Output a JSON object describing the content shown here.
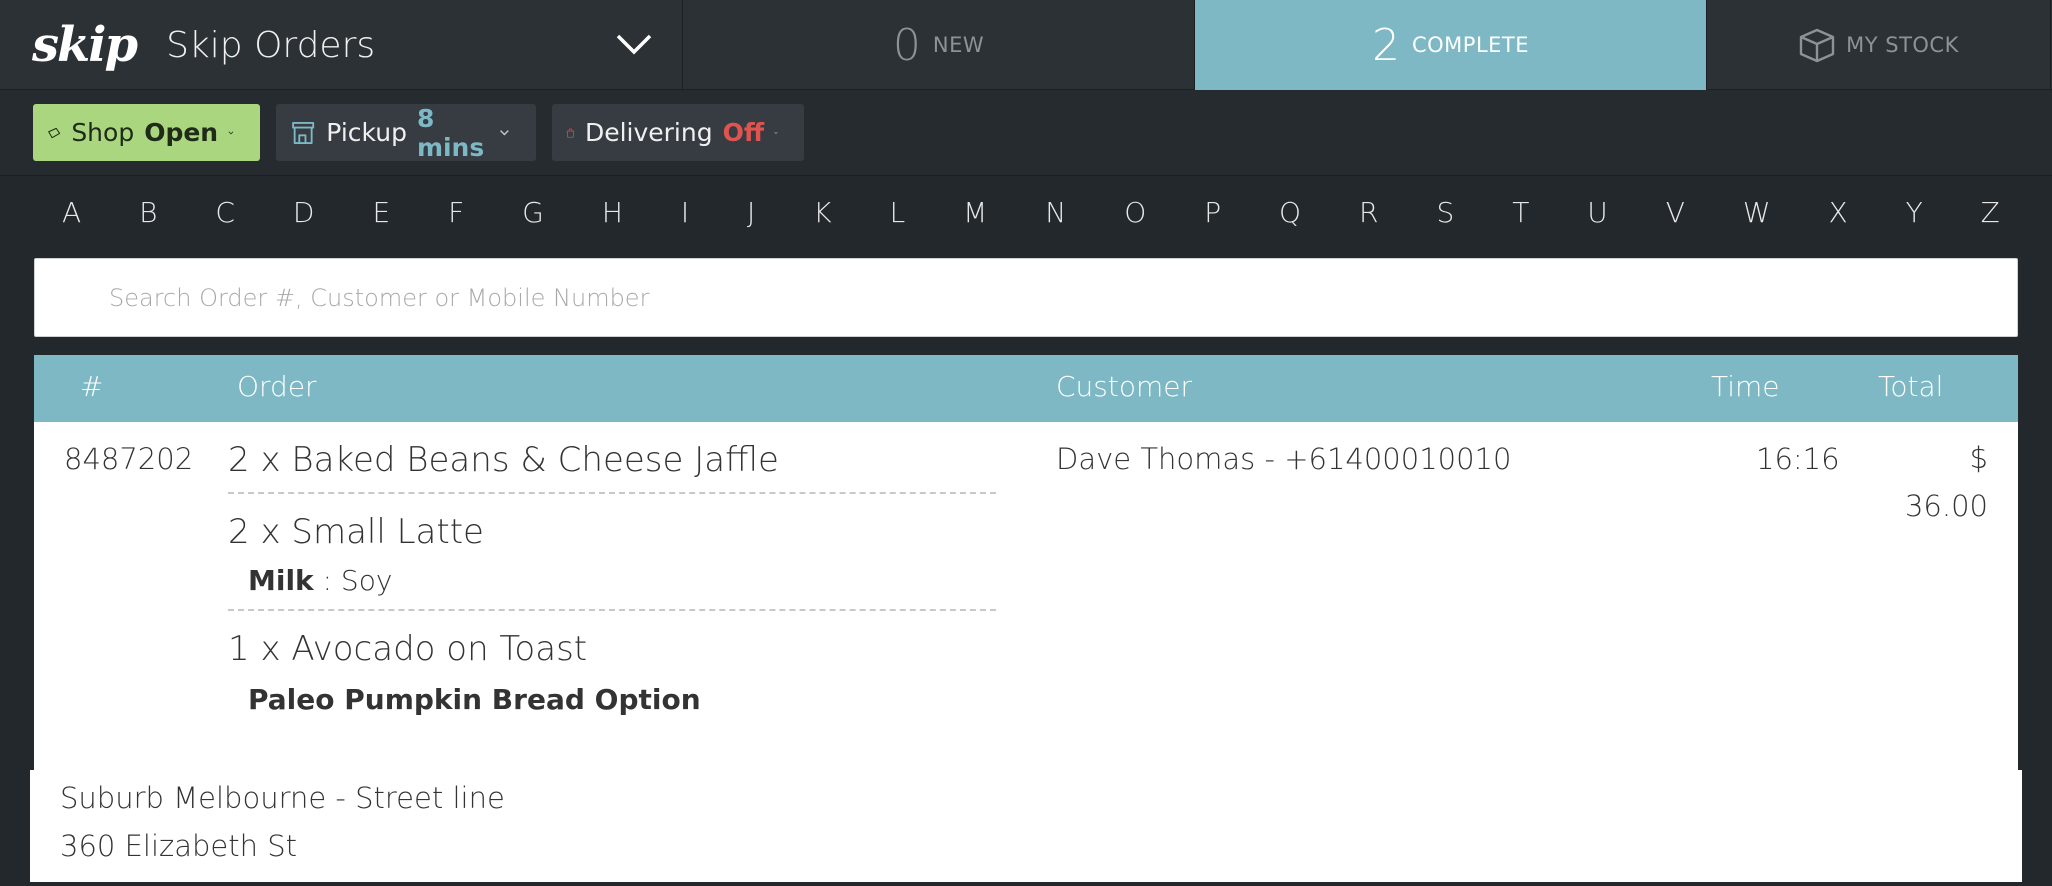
{
  "header": {
    "logo": "skip",
    "title": "Skip Orders",
    "tabs": {
      "new": {
        "count": "0",
        "label": "NEW"
      },
      "complete": {
        "count": "2",
        "label": "COMPLETE"
      },
      "stock": {
        "label": "MY STOCK"
      }
    }
  },
  "status": {
    "shop": {
      "label": "Shop",
      "value": "Open",
      "color": "#a9d67f"
    },
    "pickup": {
      "label": "Pickup",
      "value": "8 mins",
      "color": "#7db8c4"
    },
    "delivering": {
      "label": "Delivering",
      "value": "Off",
      "color": "#e0544f"
    }
  },
  "alphabet": [
    "A",
    "B",
    "C",
    "D",
    "E",
    "F",
    "G",
    "H",
    "I",
    "J",
    "K",
    "L",
    "M",
    "N",
    "O",
    "P",
    "Q",
    "R",
    "S",
    "T",
    "U",
    "V",
    "W",
    "X",
    "Y",
    "Z"
  ],
  "search": {
    "placeholder": "Search Order #, Customer or Mobile Number",
    "value": ""
  },
  "table": {
    "headers": {
      "num": "#",
      "order": "Order",
      "customer": "Customer",
      "time": "Time",
      "total": "Total"
    }
  },
  "order": {
    "number": "8487202",
    "items": [
      {
        "name": "2 x Baked Beans & Cheese Jaffle"
      },
      {
        "name": "2 x Small Latte",
        "option_key": "Milk",
        "option_sep": " : ",
        "option_val": "Soy"
      },
      {
        "name": "1 x Avocado on Toast",
        "option_full": "Paleo Pumpkin Bread Option"
      }
    ],
    "customer": "Dave Thomas - +61400010010",
    "time": "16:16",
    "total_currency": "$",
    "total_value": "36.00",
    "address_line1": "Suburb Melbourne - Street line",
    "address_line2": "360 Elizabeth St"
  },
  "colors": {
    "accent": "#7db8c4",
    "open": "#a9d67f",
    "off": "#e0544f",
    "bg": "#23282d"
  }
}
